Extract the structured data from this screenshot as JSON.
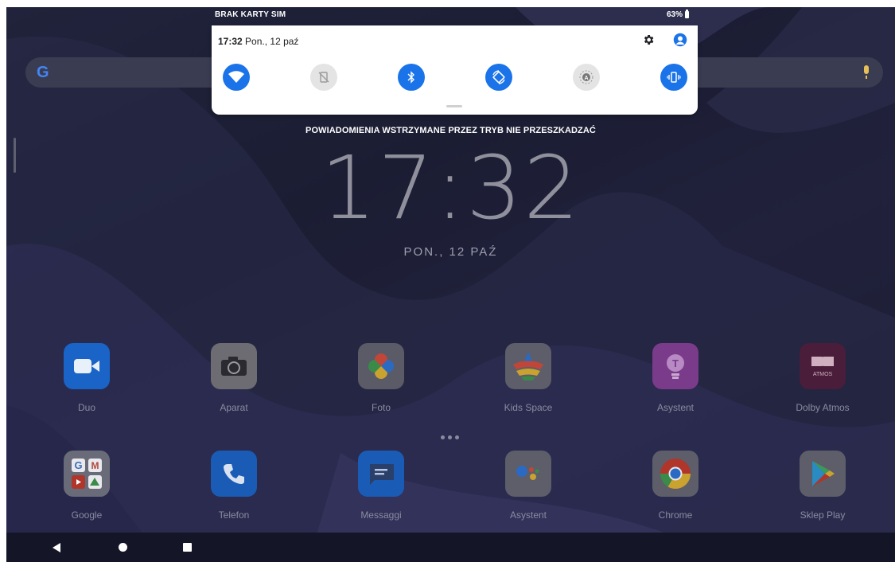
{
  "status": {
    "sim_text": "BRAK KARTY SIM",
    "battery_text": "63%"
  },
  "quick_settings": {
    "time": "17:32",
    "date": "Pon., 12 paź",
    "tiles": [
      {
        "name": "wifi-tile",
        "icon": "wifi-icon",
        "on": true
      },
      {
        "name": "mobile-data-tile",
        "icon": "no-sim-icon",
        "on": false
      },
      {
        "name": "bluetooth-tile",
        "icon": "bluetooth-icon",
        "on": true
      },
      {
        "name": "auto-rotate-tile",
        "icon": "rotate-icon",
        "on": true
      },
      {
        "name": "auto-brightness-tile",
        "icon": "brightness-icon",
        "on": false
      },
      {
        "name": "vibrate-tile",
        "icon": "vibrate-icon",
        "on": true
      }
    ]
  },
  "lockscreen": {
    "dnd_notice": "POWIADOMIENIA WSTRZYMANE PRZEZ TRYB NIE PRZESZKADZAĆ",
    "clock": "17:32",
    "date": "PON., 12 PAŹ"
  },
  "apps_row1": [
    {
      "label": "Duo",
      "icon": "duo-icon"
    },
    {
      "label": "Aparat",
      "icon": "camera-icon"
    },
    {
      "label": "Foto",
      "icon": "photos-icon"
    },
    {
      "label": "Kids Space",
      "icon": "kids-space-icon"
    },
    {
      "label": "Asystent",
      "icon": "assistant-bulb-icon"
    },
    {
      "label": "Dolby Atmos",
      "icon": "dolby-atmos-icon",
      "icon_text": "ATMOS"
    }
  ],
  "apps_row2": [
    {
      "label": "Google",
      "icon": "google-folder-icon"
    },
    {
      "label": "Telefon",
      "icon": "phone-icon"
    },
    {
      "label": "Messaggi",
      "icon": "messages-icon"
    },
    {
      "label": "Asystent",
      "icon": "google-assistant-icon"
    },
    {
      "label": "Chrome",
      "icon": "chrome-icon"
    },
    {
      "label": "Sklep Play",
      "icon": "play-store-icon"
    }
  ],
  "colors": {
    "accent": "#1a73e8",
    "panel": "#ffffff",
    "wallpaper": "#1d1f35"
  }
}
